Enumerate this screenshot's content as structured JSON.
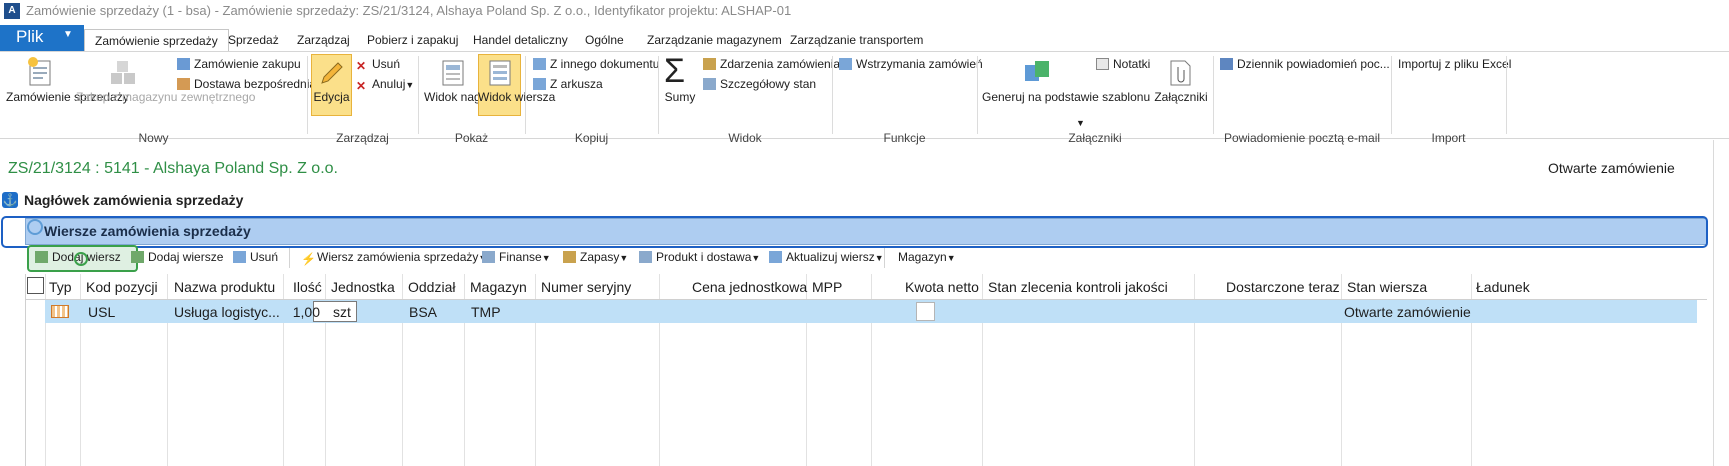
{
  "window": {
    "title": "Zamówienie sprzedaży (1 - bsa) - Zamówienie sprzedaży: ZS/21/3124, Alshaya Poland Sp. Z o.o., Identyfikator projektu: ALSHAP-01"
  },
  "file_menu": {
    "label": "Plik"
  },
  "tabs": [
    "Zamówienie sprzedaży",
    "Sprzedaż",
    "Zarządzaj",
    "Pobierz i zapakuj",
    "Handel detaliczny",
    "Ogólne",
    "Zarządzanie magazynem",
    "Zarządzanie transportem"
  ],
  "ribbon": {
    "nowy": {
      "label": "Nowy",
      "zamowienie_sprzedazy": "Zamówienie sprzedaży",
      "zakup_z_magazynu": "Zakup z magazynu zewnętrznego",
      "zamowienie_zakupu": "Zamówienie zakupu",
      "dostawa_bezposrednia": "Dostawa bezpośrednia"
    },
    "zarzadzaj": {
      "label": "Zarządzaj",
      "edycja": "Edycja",
      "usun": "Usuń",
      "anuluj": "Anuluj"
    },
    "pokaz": {
      "label": "Pokaż",
      "widok_naglowka": "Widok nagłówka",
      "widok_wiersza": "Widok wiersza"
    },
    "kopiuj": {
      "label": "Kopiuj",
      "z_innego": "Z innego dokumentu",
      "z_arkusza": "Z arkusza"
    },
    "widok": {
      "label": "Widok",
      "sumy": "Sumy",
      "zdarzenia": "Zdarzenia zamówienia",
      "szczegolowy": "Szczegółowy stan"
    },
    "funkcje": {
      "label": "Funkcje",
      "wstrzymania": "Wstrzymania zamówień"
    },
    "zalaczniki": {
      "label": "Załączniki",
      "generuj": "Generuj na podstawie szablonu",
      "notatki": "Notatki",
      "zalaczniki": "Załączniki"
    },
    "email": {
      "label": "Powiadomienie pocztą e-mail",
      "dziennik": "Dziennik powiadomień poc..."
    },
    "import": {
      "label": "Import",
      "excel": "Importuj z pliku Excel"
    }
  },
  "header": {
    "doc_title": "ZS/21/3124 : 5141 - Alshaya Poland Sp. Z o.o.",
    "status": "Otwarte zamówienie",
    "fasttab_header": "Nagłówek zamówienia sprzedaży",
    "fasttab_lines": "Wiersze zamówienia sprzedaży"
  },
  "lines_toolbar": {
    "dodaj_wiersz": "Dodaj wiersz",
    "dodaj_wiersze": "Dodaj wiersze",
    "usun": "Usuń",
    "wiersz_zamowienia": "Wiersz zamówienia sprzedaży",
    "finanse": "Finanse",
    "zapasy": "Zapasy",
    "produkt": "Produkt i dostawa",
    "aktualizuj": "Aktualizuj wiersz",
    "magazyn": "Magazyn"
  },
  "grid": {
    "columns": [
      "Typ",
      "Kod pozycji",
      "Nazwa produktu",
      "Ilość",
      "Jednostka",
      "Oddział",
      "Magazyn",
      "Numer seryjny",
      "Cena jednostkowa",
      "MPP",
      "Kwota netto",
      "Stan zlecenia kontroli jakości",
      "Dostarczone teraz",
      "Stan wiersza",
      "Ładunek"
    ],
    "rows": [
      {
        "kod": "USL",
        "nazwa": "Usługa logistyc...",
        "ilosc": "1,00",
        "jednostka": "szt",
        "oddzial": "BSA",
        "magazyn": "TMP",
        "stan": "Otwarte zamówienie"
      }
    ]
  },
  "colors": {
    "accent": "#1e73c8",
    "doc_title": "#2f8f46",
    "selected_row": "#bfe0f7",
    "lines_header": "#aecdf1",
    "active_toggle": "#fbe08a"
  }
}
